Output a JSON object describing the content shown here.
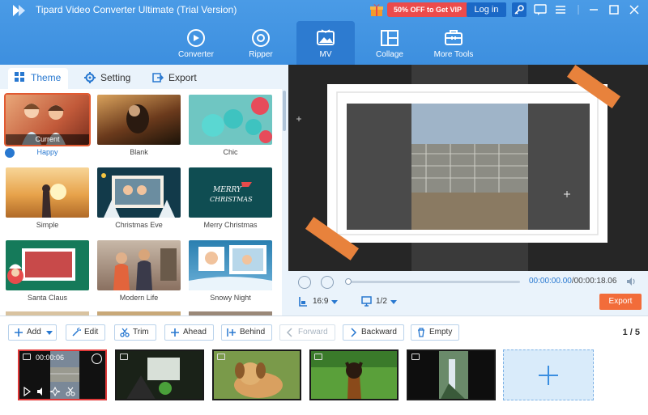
{
  "window": {
    "title": "Tipard Video Converter Ultimate (Trial Version)",
    "promo_label": "50% OFF to Get VIP",
    "login_label": "Log in"
  },
  "nav": {
    "tabs": [
      {
        "label": "Converter",
        "icon": "converter-icon"
      },
      {
        "label": "Ripper",
        "icon": "disc-icon"
      },
      {
        "label": "MV",
        "icon": "mv-image-icon",
        "active": true
      },
      {
        "label": "Collage",
        "icon": "collage-icon"
      },
      {
        "label": "More Tools",
        "icon": "toolbox-icon"
      }
    ]
  },
  "left": {
    "subtabs": [
      {
        "label": "Theme",
        "active": true
      },
      {
        "label": "Setting"
      },
      {
        "label": "Export"
      }
    ],
    "themes": [
      {
        "label": "Happy",
        "tag": "Current",
        "selected": true
      },
      {
        "label": "Blank"
      },
      {
        "label": "Chic"
      },
      {
        "label": "Simple"
      },
      {
        "label": "Christmas Eve"
      },
      {
        "label": "Merry Christmas"
      },
      {
        "label": "Santa Claus"
      },
      {
        "label": "Modern Life"
      },
      {
        "label": "Snowy Night"
      }
    ]
  },
  "player": {
    "time_current": "00:00:00.00",
    "time_total": "/00:00:18.06",
    "aspect_ratio": "16:9",
    "screen_ratio": "1/2",
    "export_label": "Export",
    "progress": 0.0
  },
  "toolbar": {
    "add": "Add",
    "edit": "Edit",
    "trim": "Trim",
    "ahead": "Ahead",
    "behind": "Behind",
    "forward": "Forward",
    "backward": "Backward",
    "empty": "Empty",
    "page_count": "1 / 5"
  },
  "timeline": {
    "clips": [
      {
        "duration": "00:00:06",
        "selected": true
      },
      {},
      {},
      {},
      {}
    ]
  },
  "colors": {
    "accent": "#2878d0",
    "header": "#3d8fdf",
    "export": "#f26c3a",
    "promo": "#ec4b4b"
  }
}
